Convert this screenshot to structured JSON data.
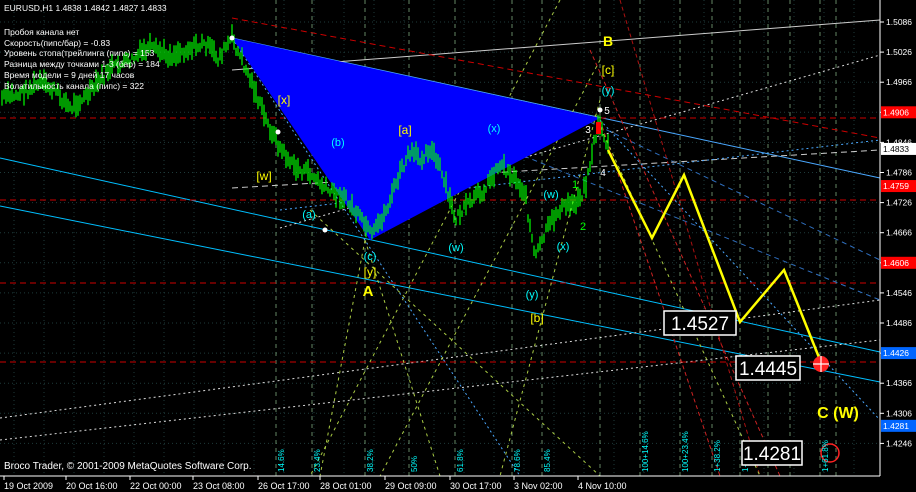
{
  "window": {
    "title": "EURUSD,H1  1.4838 1.4842 1.4827 1.4833"
  },
  "info_lines": [
    "Пробоя канала нет",
    "Скорость(пипс/бар) = -0.83",
    "Уровень стопа(трейлинга (пипс) = 153",
    "Разница между точками 1-3 (бар) = 184",
    "Время модели = 9 дней 17 часов",
    "Волатильность канала (пипс) = 322"
  ],
  "copyright": "Broco Trader, © 2001-2009 MetaQuotes Software Corp.",
  "colors": {
    "background": "#000000",
    "candles": "#00ff00",
    "triangle": "#0000ff",
    "forecast": "#ffff00",
    "channel": "#00bfff",
    "fibo": "#00ffff",
    "red_level": "#cc0000",
    "current_price_box": "#ffffff",
    "blue_price_box": "#0066ff",
    "red_price_box": "#ff0000"
  },
  "chart_data": {
    "type": "candlestick",
    "symbol": "EURUSD",
    "timeframe": "H1",
    "ohlc": {
      "open": 1.4838,
      "high": 1.4842,
      "low": 1.4827,
      "close": 1.4833
    },
    "ylim": [
      1.4233,
      1.5092
    ],
    "x_tick_labels": [
      "19 Oct 2009",
      "20 Oct 16:00",
      "22 Oct 00:00",
      "23 Oct 08:00",
      "26 Oct 17:00",
      "28 Oct 01:00",
      "29 Oct 09:00",
      "30 Oct 17:00",
      "3 Nov 02:00",
      "4 Nov 10:00"
    ],
    "y_tick_labels": [
      "1.5086",
      "1.5026",
      "1.4966",
      "1.4906",
      "1.4846",
      "1.4786",
      "1.4726",
      "1.4666",
      "1.4606",
      "1.4546",
      "1.4486",
      "1.4426",
      "1.4366",
      "1.4306",
      "1.4246"
    ],
    "price_markers": [
      {
        "text": "1.4906",
        "value": 1.4906,
        "style": "red"
      },
      {
        "text": "1.4833",
        "value": 1.4833,
        "style": "current"
      },
      {
        "text": "1.4759",
        "value": 1.4759,
        "style": "red"
      },
      {
        "text": "1.4606",
        "value": 1.4606,
        "style": "red"
      },
      {
        "text": "1.4426",
        "value": 1.4426,
        "style": "blue"
      },
      {
        "text": "1.4281",
        "value": 1.4281,
        "style": "blue"
      }
    ],
    "forecast_labels": [
      "1.4527",
      "1.4445",
      "1.4281"
    ],
    "wave_labels": [
      {
        "text": "B",
        "color": "#ffff00"
      },
      {
        "text": "[c]",
        "color": "#ffff00"
      },
      {
        "text": "(y)",
        "color": "#00ffff"
      },
      {
        "text": "[x]",
        "color": "#ffff00"
      },
      {
        "text": "(b)",
        "color": "#00ffff"
      },
      {
        "text": "[a]",
        "color": "#ffff00"
      },
      {
        "text": "(x)",
        "color": "#00ffff"
      },
      {
        "text": "[w]",
        "color": "#ffff00"
      },
      {
        "text": "(w)",
        "color": "#00ffff"
      },
      {
        "text": "1",
        "color": "#00ff00"
      },
      {
        "text": "(a)",
        "color": "#00ffff"
      },
      {
        "text": "2",
        "color": "#00ff00"
      },
      {
        "text": "(w)",
        "color": "#00ffff"
      },
      {
        "text": "(c)",
        "color": "#00ffff"
      },
      {
        "text": "(x)",
        "color": "#00ffff"
      },
      {
        "text": "[y]",
        "color": "#ffff00"
      },
      {
        "text": "A",
        "color": "#ffff00"
      },
      {
        "text": "(y)",
        "color": "#00ffff"
      },
      {
        "text": "[b]",
        "color": "#ffff00"
      },
      {
        "text": "C (W)",
        "color": "#ffff00"
      },
      {
        "text": "3",
        "color": "#ffffff"
      },
      {
        "text": "4",
        "color": "#ffffff"
      },
      {
        "text": "5",
        "color": "#ffffff"
      }
    ],
    "fibo_labels": [
      "14.6%",
      "23.4%",
      "38.2%",
      "50%",
      "61.8%",
      "78.6%",
      "85.4%",
      "100+14.6%",
      "100+23.4%",
      "1+38.2%",
      "1+50%",
      "1+61.8%"
    ]
  }
}
